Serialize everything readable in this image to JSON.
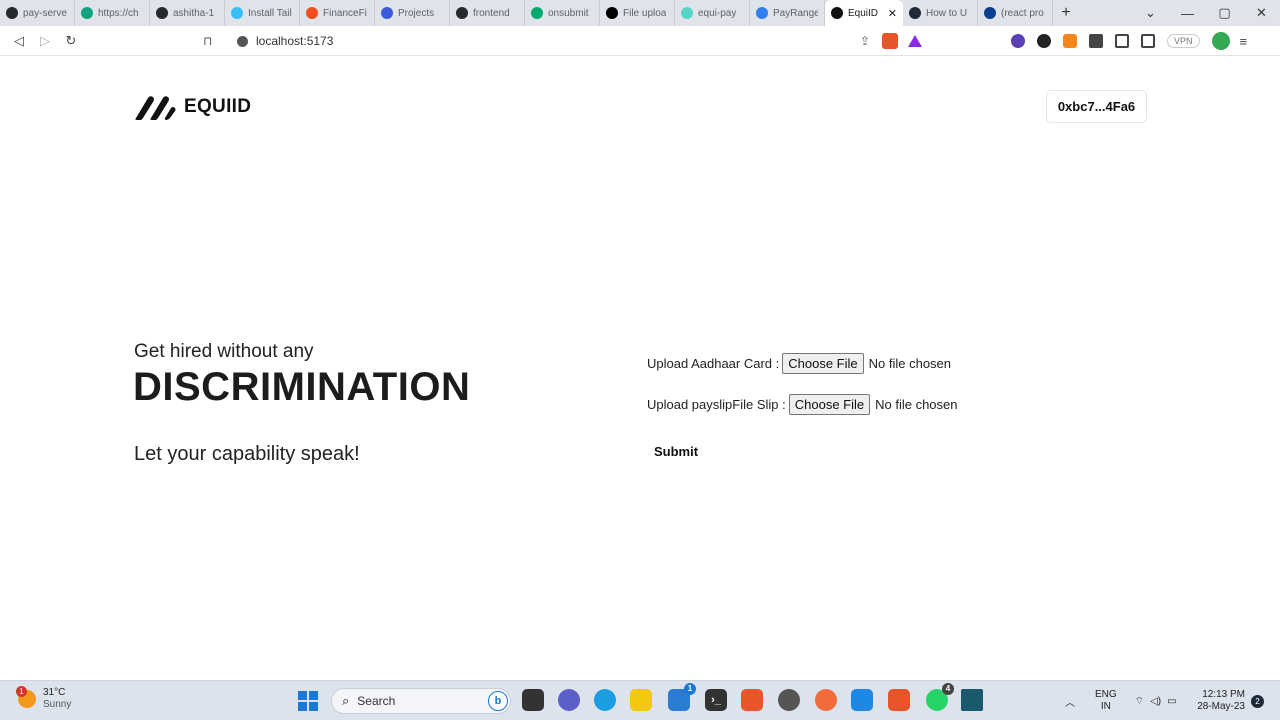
{
  "browser": {
    "tabs": [
      {
        "label": "pay-serve",
        "icon": "github-icon",
        "color": "#24292e"
      },
      {
        "label": "https://ch",
        "icon": "chatgpt-icon",
        "color": "#10a37f"
      },
      {
        "label": "ashitha-1",
        "icon": "github-icon",
        "color": "#24292e"
      },
      {
        "label": "Install Tail",
        "icon": "tailwind-icon",
        "color": "#38bdf8"
      },
      {
        "label": "FinanceFi",
        "icon": "figma-icon",
        "color": "#f24e1e"
      },
      {
        "label": "Projects",
        "icon": "projects-icon",
        "color": "#3b5bdb"
      },
      {
        "label": "frontend",
        "icon": "github-icon",
        "color": "#24292e"
      },
      {
        "label": "onsubmit",
        "icon": "w3schools-icon",
        "color": "#04aa6d"
      },
      {
        "label": "File uploa",
        "icon": "dev-icon",
        "color": "#000000"
      },
      {
        "label": "equi-pay",
        "icon": "replit-icon",
        "color": "#56d4c6"
      },
      {
        "label": "PayRange",
        "icon": "payrange-icon",
        "color": "#2f80ed"
      },
      {
        "label": "EquiID",
        "icon": "equiid-icon",
        "color": "#111111",
        "active": true
      },
      {
        "label": "How to U",
        "icon": "a-icon",
        "color": "#1f2a38"
      },
      {
        "label": "(react pro",
        "icon": "react-icon",
        "color": "#0b3d91"
      }
    ],
    "active_tab_close": "✕",
    "new_tab": "+",
    "url": "localhost:5173",
    "vpn_label": "VPN"
  },
  "page": {
    "brand": "EQUIID",
    "wallet_address": "0xbc7...4Fa6",
    "tagline": "Get hired without any",
    "headline": "DISCRIMINATION",
    "subline": "Let your capability speak!",
    "form": {
      "aadhaar_label": "Upload Aadhaar Card :",
      "payslip_label": "Upload payslipFile Slip :",
      "choose_file": "Choose File",
      "no_file": "No file chosen",
      "submit": "Submit"
    }
  },
  "taskbar": {
    "weather_temp": "31°C",
    "weather_condition": "Sunny",
    "weather_badge": "1",
    "search_placeholder": "Search",
    "lang_top": "ENG",
    "lang_bottom": "IN",
    "time": "12:13 PM",
    "date": "28-May-23",
    "notification_count": "2",
    "vscode_badge": "1",
    "whatsapp_badge": "4"
  }
}
